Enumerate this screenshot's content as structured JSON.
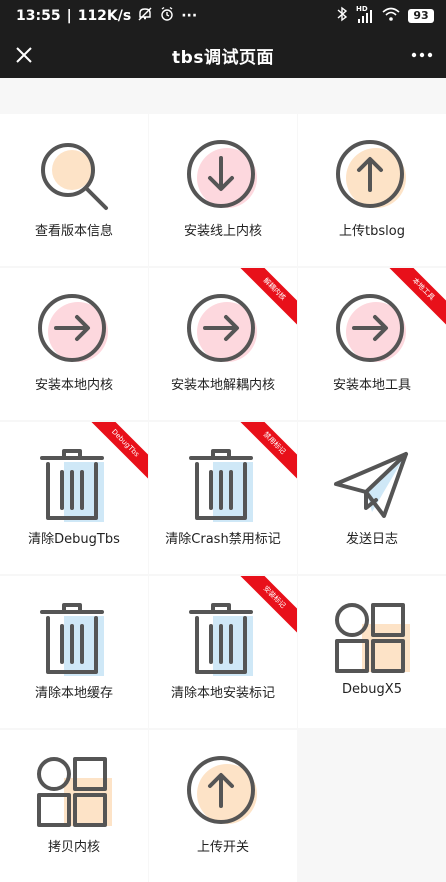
{
  "status_bar": {
    "time": "13:55",
    "speed": "112K/s",
    "more": "···",
    "network": "HD",
    "battery": "93"
  },
  "title_bar": {
    "title": "tbs调试页面"
  },
  "items": [
    {
      "label": "查看版本信息",
      "icon": "search-icon",
      "accent": "#fde3c7"
    },
    {
      "label": "安装线上内核",
      "icon": "download-arrow-icon",
      "accent": "#fdd8de"
    },
    {
      "label": "上传tbslog",
      "icon": "upload-arrow-icon",
      "accent": "#fde3c7"
    },
    {
      "label": "安装本地内核",
      "icon": "arrow-right-icon",
      "accent": "#fdd8de"
    },
    {
      "label": "安装本地解耦内核",
      "icon": "arrow-right-icon",
      "accent": "#fdd8de",
      "ribbon": "解耦内核"
    },
    {
      "label": "安装本地工具",
      "icon": "arrow-right-icon",
      "accent": "#fdd8de",
      "ribbon": "本地工具"
    },
    {
      "label": "清除DebugTbs",
      "icon": "trash-icon",
      "accent": "#cfe8f7",
      "ribbon": "DebugTbs"
    },
    {
      "label": "清除Crash禁用标记",
      "icon": "trash-icon",
      "accent": "#cfe8f7",
      "ribbon": "禁用标记"
    },
    {
      "label": "发送日志",
      "icon": "paper-plane-icon",
      "accent": "#cfe8f7"
    },
    {
      "label": "清除本地缓存",
      "icon": "trash-icon",
      "accent": "#cfe8f7"
    },
    {
      "label": "清除本地安装标记",
      "icon": "trash-icon",
      "accent": "#cfe8f7",
      "ribbon": "安装标记"
    },
    {
      "label": "DebugX5",
      "icon": "grid-apps-icon",
      "accent": "#fde3c7"
    },
    {
      "label": "拷贝内核",
      "icon": "grid-apps-icon",
      "accent": "#fde3c7"
    },
    {
      "label": "上传开关",
      "icon": "upload-arrow-icon",
      "accent": "#fde3c7"
    }
  ],
  "colors": {
    "bar_bg": "#1d1d1d",
    "icon_stroke": "#555555",
    "ribbon": "#e8101a"
  }
}
